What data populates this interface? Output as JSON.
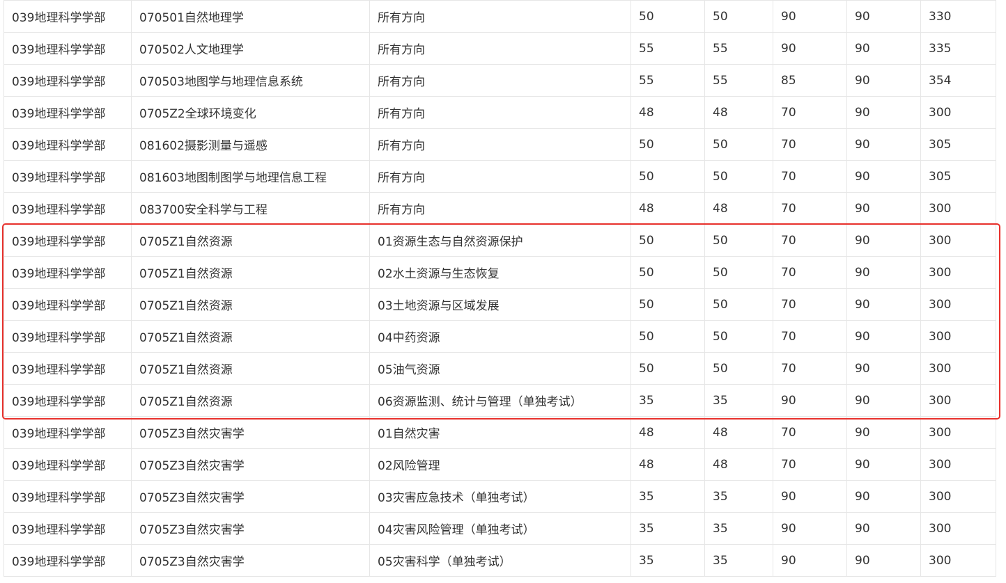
{
  "highlight": {
    "color": "#e8312c",
    "rows": [
      7,
      8,
      9,
      10,
      11,
      12
    ]
  },
  "rows": [
    [
      "039地理科学学部",
      "070501自然地理学",
      "所有方向",
      "50",
      "50",
      "90",
      "90",
      "330"
    ],
    [
      "039地理科学学部",
      "070502人文地理学",
      "所有方向",
      "55",
      "55",
      "90",
      "90",
      "335"
    ],
    [
      "039地理科学学部",
      "070503地图学与地理信息系统",
      "所有方向",
      "55",
      "55",
      "85",
      "90",
      "354"
    ],
    [
      "039地理科学学部",
      "0705Z2全球环境变化",
      "所有方向",
      "48",
      "48",
      "70",
      "90",
      "300"
    ],
    [
      "039地理科学学部",
      "081602摄影测量与遥感",
      "所有方向",
      "50",
      "50",
      "70",
      "90",
      "305"
    ],
    [
      "039地理科学学部",
      "081603地图制图学与地理信息工程",
      "所有方向",
      "50",
      "50",
      "70",
      "90",
      "305"
    ],
    [
      "039地理科学学部",
      "083700安全科学与工程",
      "所有方向",
      "48",
      "48",
      "70",
      "90",
      "300"
    ],
    [
      "039地理科学学部",
      "0705Z1自然资源",
      "01资源生态与自然资源保护",
      "50",
      "50",
      "70",
      "90",
      "300"
    ],
    [
      "039地理科学学部",
      "0705Z1自然资源",
      "02水土资源与生态恢复",
      "50",
      "50",
      "70",
      "90",
      "300"
    ],
    [
      "039地理科学学部",
      "0705Z1自然资源",
      "03土地资源与区域发展",
      "50",
      "50",
      "70",
      "90",
      "300"
    ],
    [
      "039地理科学学部",
      "0705Z1自然资源",
      "04中药资源",
      "50",
      "50",
      "70",
      "90",
      "300"
    ],
    [
      "039地理科学学部",
      "0705Z1自然资源",
      "05油气资源",
      "50",
      "50",
      "70",
      "90",
      "300"
    ],
    [
      "039地理科学学部",
      "0705Z1自然资源",
      "06资源监测、统计与管理（单独考试）",
      "35",
      "35",
      "90",
      "90",
      "300"
    ],
    [
      "039地理科学学部",
      "0705Z3自然灾害学",
      "01自然灾害",
      "48",
      "48",
      "70",
      "90",
      "300"
    ],
    [
      "039地理科学学部",
      "0705Z3自然灾害学",
      "02风险管理",
      "48",
      "48",
      "70",
      "90",
      "300"
    ],
    [
      "039地理科学学部",
      "0705Z3自然灾害学",
      "03灾害应急技术（单独考试）",
      "35",
      "35",
      "90",
      "90",
      "300"
    ],
    [
      "039地理科学学部",
      "0705Z3自然灾害学",
      "04灾害风险管理（单独考试）",
      "35",
      "35",
      "90",
      "90",
      "300"
    ],
    [
      "039地理科学学部",
      "0705Z3自然灾害学",
      "05灾害科学（单独考试）",
      "35",
      "35",
      "90",
      "90",
      "300"
    ]
  ]
}
